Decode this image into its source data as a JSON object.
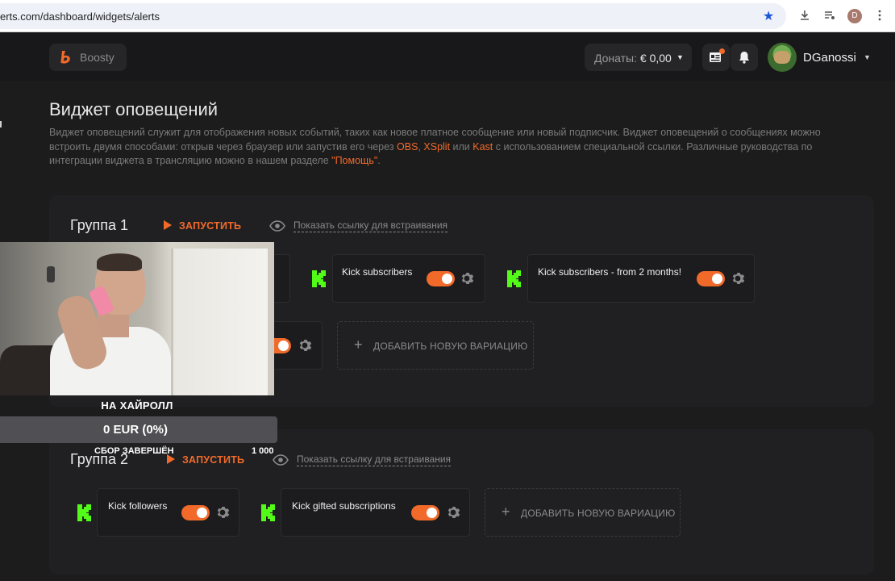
{
  "browser": {
    "url": "erts.com/dashboard/widgets/alerts",
    "profile_initial": "D"
  },
  "header": {
    "logo_text": "Boosty",
    "donations_label": "Донаты: ",
    "donations_value": "€ 0,00",
    "user_name": "DGanossi"
  },
  "page": {
    "title": "Виджет оповещений",
    "description_part1": "Виджет оповещений служит для отображения новых событий, таких как новое платное сообщение или новый подписчик. Виджет оповещений о сообщениях можно встроить двумя способами: открыв через браузер или запустив его через ",
    "link_obs": "OBS",
    "sep1": ", ",
    "link_xsplit": "XSplit",
    "sep2": " или ",
    "link_kast": "Kast",
    "description_part2": " с использованием специальной ссылки. Различные руководства по интеграции виджета в трансляцию можно в нашем разделе ",
    "link_help": "\"Помощь\"",
    "description_end": "."
  },
  "groups": [
    {
      "title": "Группа 1",
      "run_label": "ЗАПУСТИТЬ",
      "embed_label": "Показать ссылку для встраивания",
      "variations": [
        {
          "name": "Kick subscribers",
          "enabled": true
        },
        {
          "name": "Kick subscribers - from 2 months!",
          "enabled": true
        },
        {
          "name": "",
          "enabled": true
        }
      ],
      "add_label": "ДОБАВИТЬ НОВУЮ ВАРИАЦИЮ"
    },
    {
      "title": "Группа 2",
      "run_label": "ЗАПУСТИТЬ",
      "embed_label": "Показать ссылку для встраивания",
      "variations": [
        {
          "name": "Kick followers",
          "enabled": true
        },
        {
          "name": "Kick gifted subscriptions",
          "enabled": true
        }
      ],
      "add_label": "ДОБАВИТЬ НОВУЮ ВАРИАЦИЮ"
    }
  ],
  "overlay": {
    "goal_title": "НА ХАЙРОЛЛ",
    "goal_amount": "0 EUR (0%)",
    "goal_status": "СБОР ЗАВЕРШЁН",
    "goal_target": "1 000"
  },
  "colors": {
    "accent": "#f26a2a",
    "kick_green": "#53fc18",
    "background": "#1c1c1d",
    "panel": "#202022"
  },
  "icons": [
    "star-icon",
    "download-icon",
    "playlist-icon",
    "menu-dots-icon",
    "boosty-logo-icon",
    "news-icon",
    "bell-icon",
    "eye-icon",
    "play-icon",
    "kick-logo-icon",
    "gear-icon",
    "plus-icon"
  ]
}
